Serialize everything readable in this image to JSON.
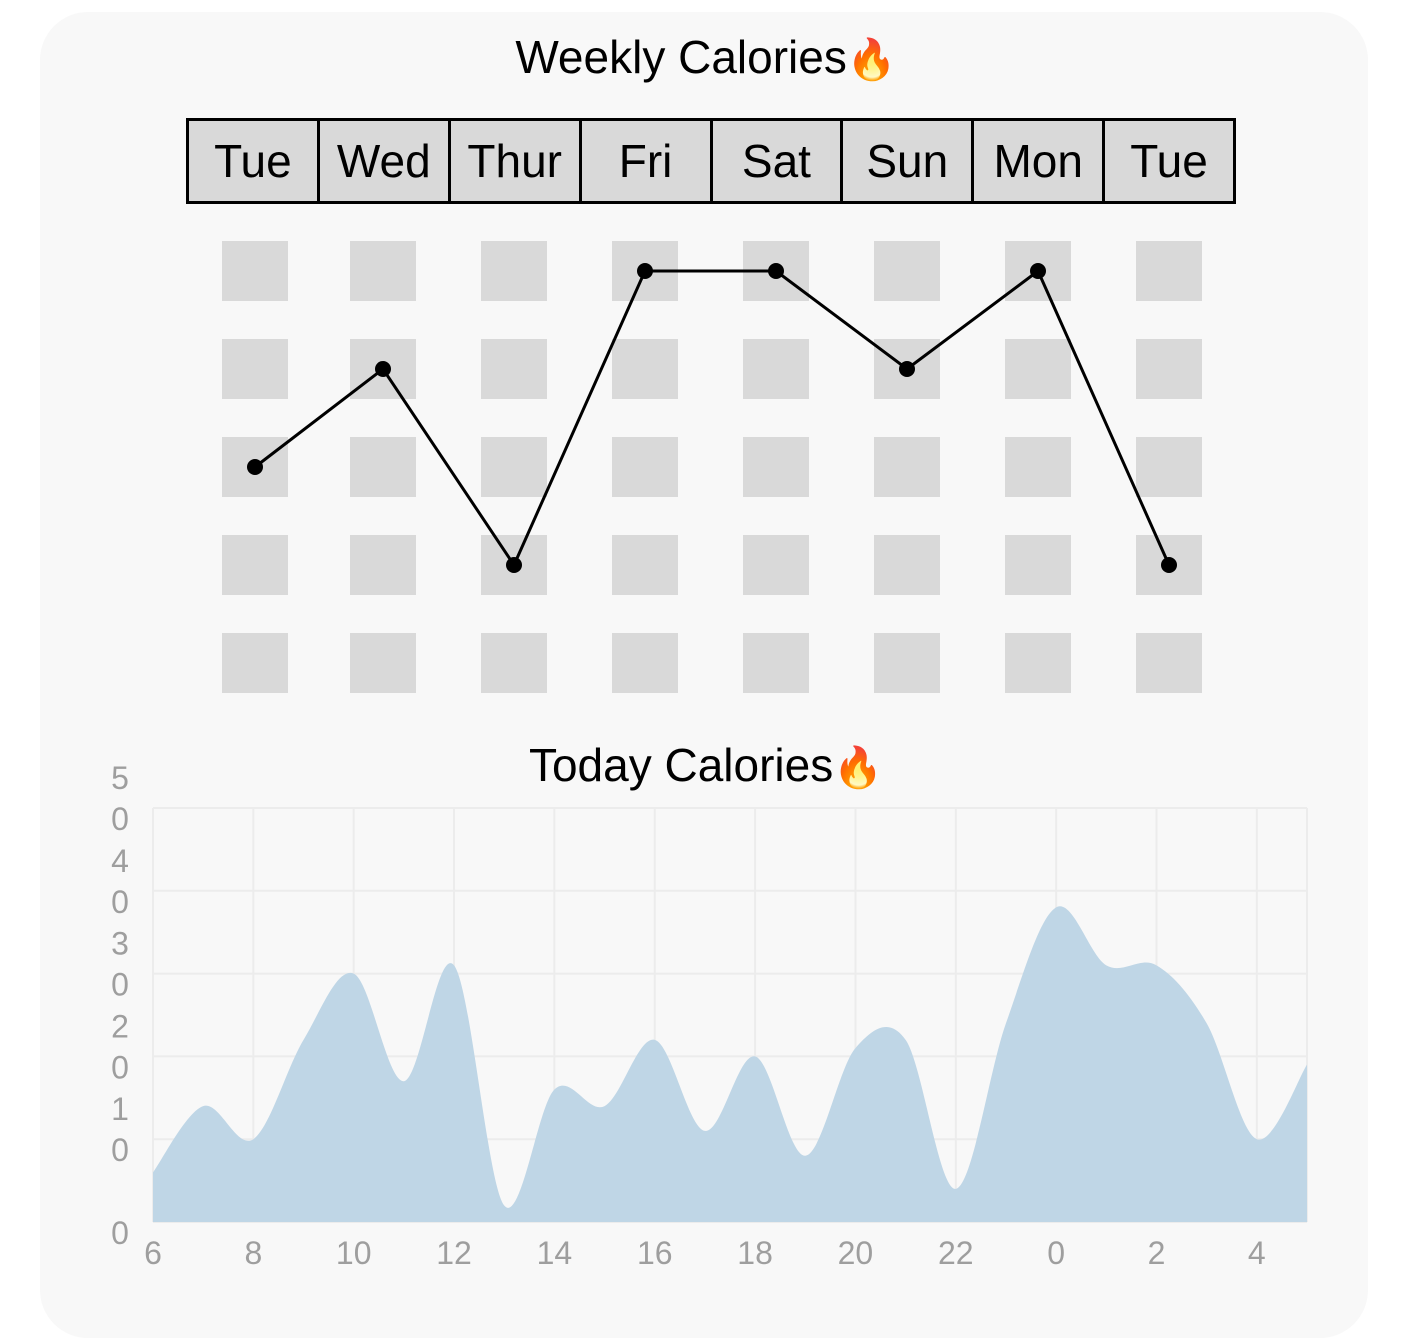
{
  "weekly": {
    "title": "Weekly Calories",
    "title_icon": "🔥",
    "days": [
      "Tue",
      "Wed",
      "Thur",
      "Fri",
      "Sat",
      "Sun",
      "Mon",
      "Tue"
    ]
  },
  "today": {
    "title": "Today Calories",
    "title_icon": "🔥"
  },
  "colors": {
    "cell": "#d9d9d9",
    "line": "#000000",
    "area": "#bfd6e6",
    "grid": "#ececec",
    "tick": "#9e9e9e",
    "card": "#f8f8f8"
  },
  "chart_data": [
    {
      "type": "line",
      "categories": [
        "Tue",
        "Wed",
        "Thur",
        "Fri",
        "Sat",
        "Sun",
        "Mon",
        "Tue"
      ],
      "levels": 5,
      "values": [
        3,
        4,
        2,
        5,
        5,
        4,
        5,
        2
      ],
      "grid": "dot-matrix"
    },
    {
      "type": "area",
      "x_ticks": [
        "6",
        "8",
        "10",
        "12",
        "14",
        "16",
        "18",
        "20",
        "22",
        "0",
        "2",
        "4"
      ],
      "y_ticks": [
        "0",
        "10",
        "20",
        "30",
        "40",
        "50"
      ],
      "ylim": [
        0,
        50
      ],
      "hours": [
        6,
        7,
        8,
        9,
        10,
        11,
        12,
        13,
        14,
        15,
        16,
        17,
        18,
        19,
        20,
        21,
        22,
        23,
        24,
        25,
        26,
        27,
        28,
        29
      ],
      "values": [
        6,
        14,
        10,
        22,
        30,
        17,
        31,
        2,
        16,
        14,
        22,
        11,
        20,
        8,
        21,
        22,
        4,
        24,
        38,
        31,
        31,
        24,
        10,
        19
      ],
      "grid": true
    }
  ]
}
